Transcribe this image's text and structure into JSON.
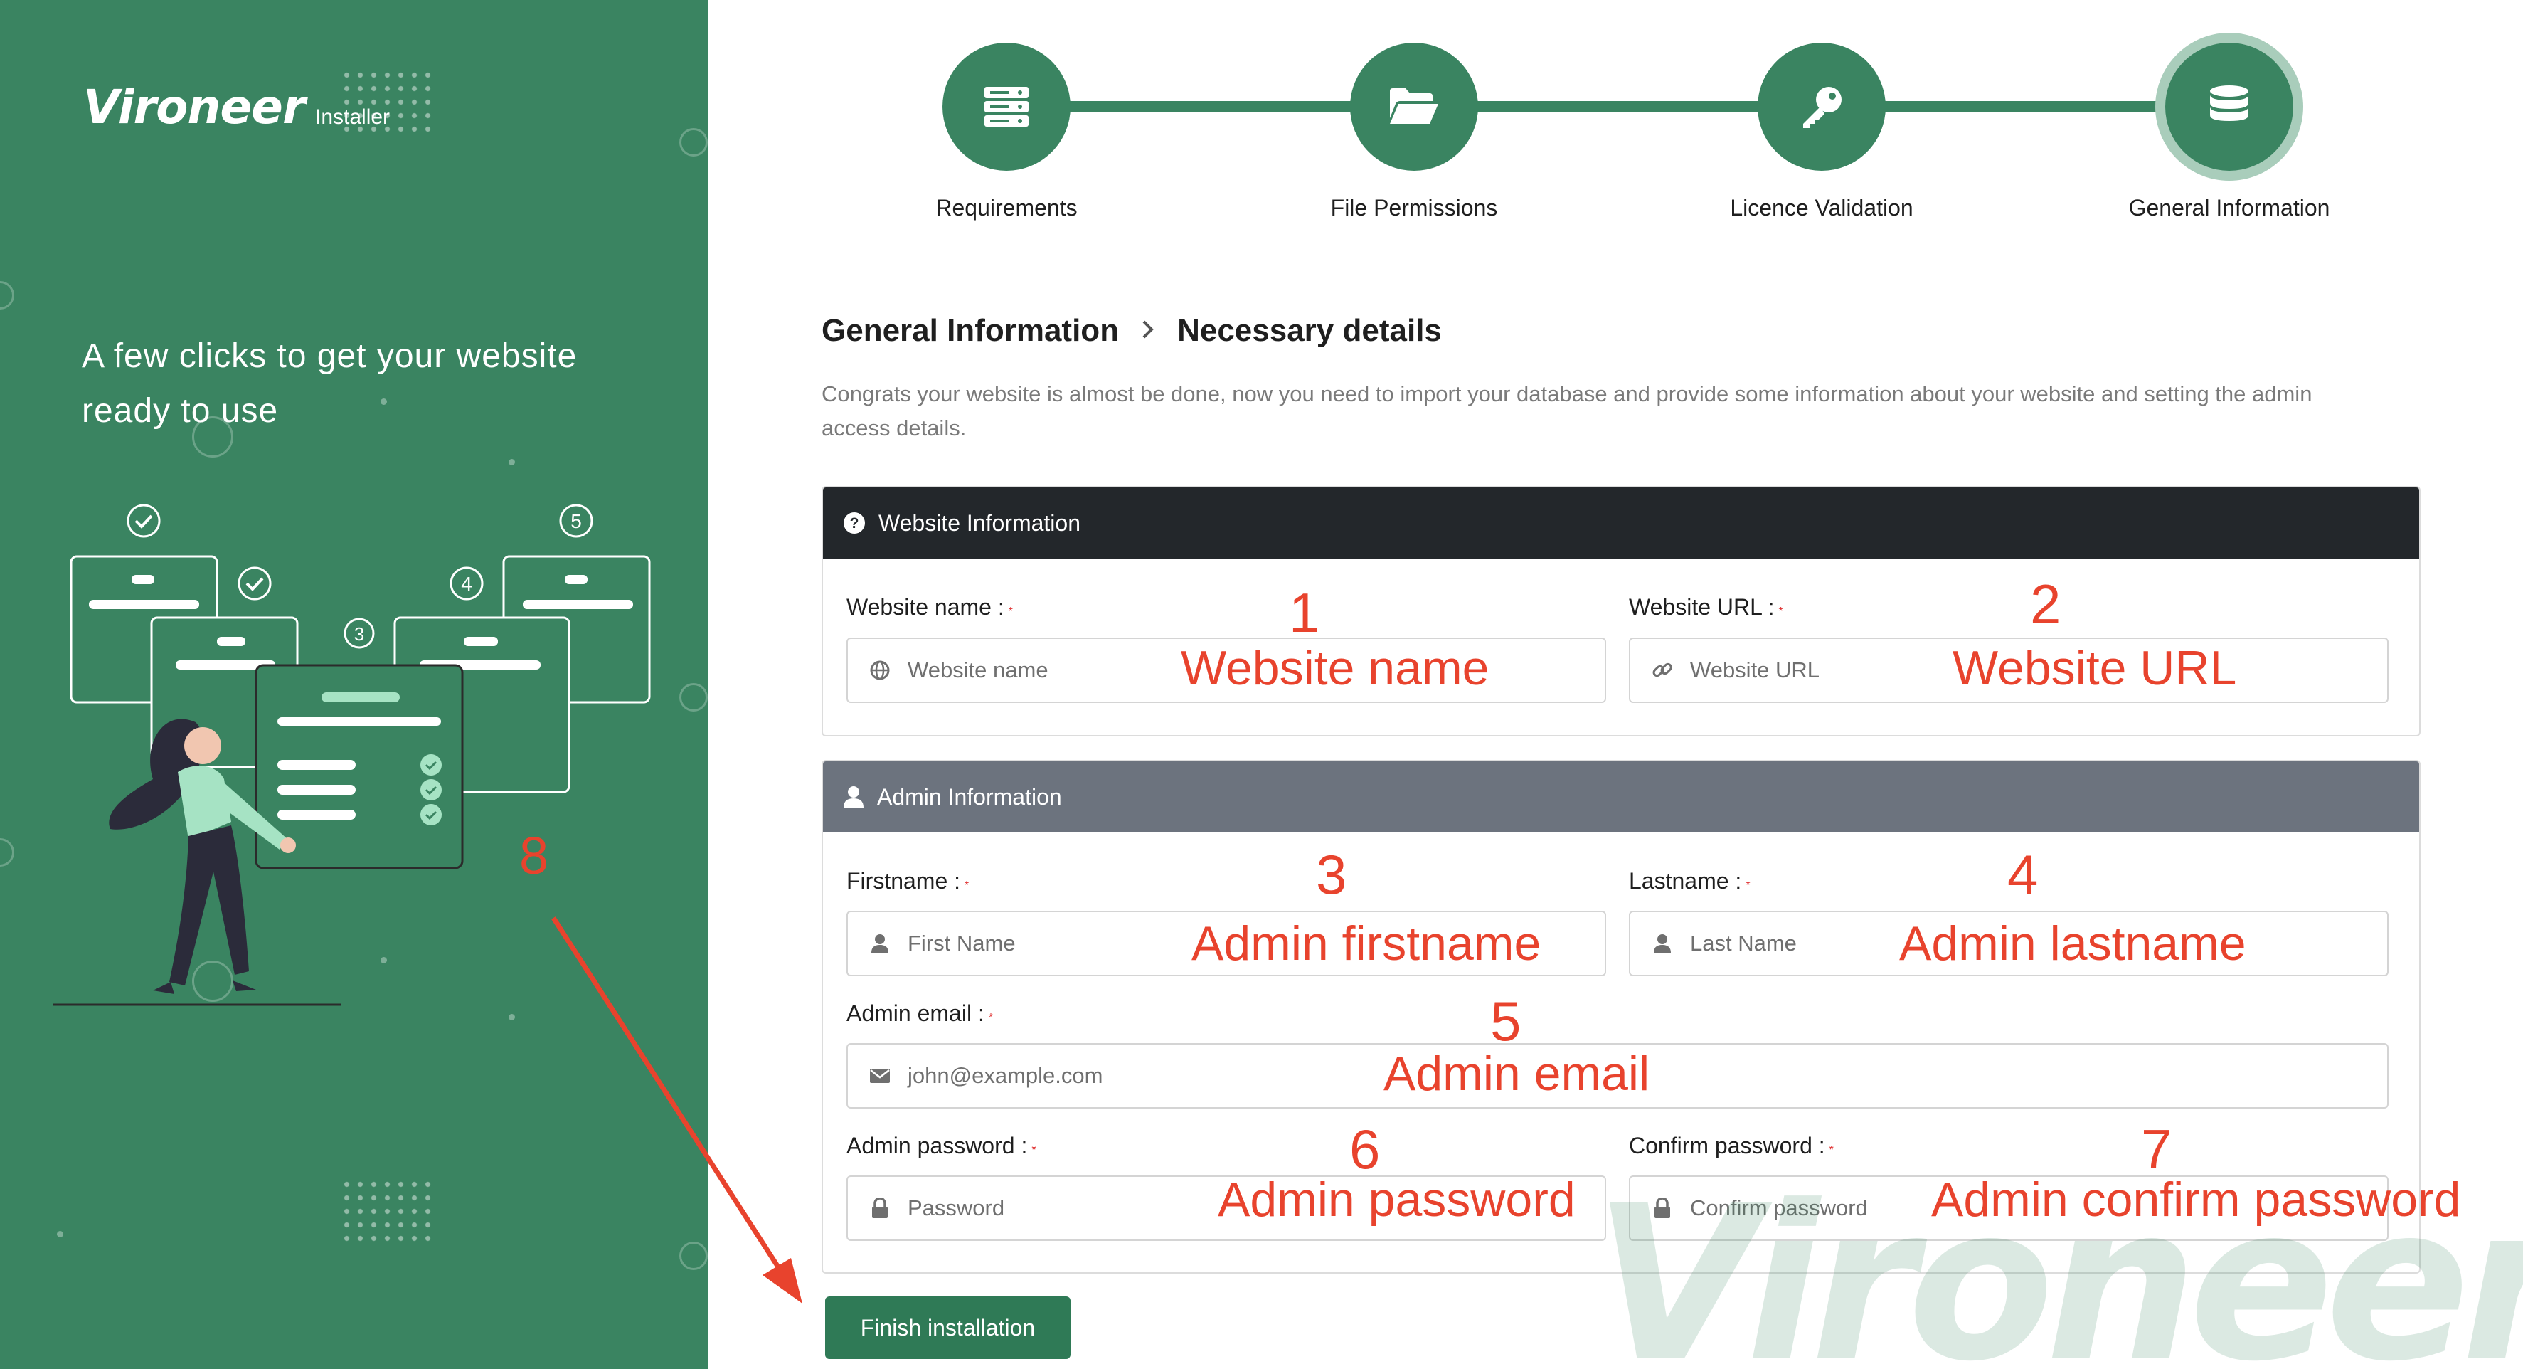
{
  "brand": {
    "name": "Vironeer",
    "sub": "Installer",
    "tagline": "A few clicks to get your website ready to use"
  },
  "steps": [
    {
      "label": "Requirements",
      "icon": "server-icon"
    },
    {
      "label": "File Permissions",
      "icon": "folder-open-icon"
    },
    {
      "label": "Licence Validation",
      "icon": "key-icon"
    },
    {
      "label": "General Information",
      "icon": "database-icon",
      "active": true
    }
  ],
  "illustration": {
    "steps": [
      "3",
      "4",
      "5"
    ]
  },
  "breadcrumb": {
    "parent": "General Information",
    "current": "Necessary details"
  },
  "intro": "Congrats your website is almost be done, now you need to import your database and provide some information about your website and setting the admin access details.",
  "website_section": {
    "title": "Website Information",
    "name_label": "Website name :",
    "name_placeholder": "Website name",
    "url_label": "Website URL :",
    "url_placeholder": "Website URL"
  },
  "admin_section": {
    "title": "Admin Information",
    "firstname_label": "Firstname :",
    "firstname_placeholder": "First Name",
    "lastname_label": "Lastname :",
    "lastname_placeholder": "Last Name",
    "email_label": "Admin email :",
    "email_placeholder": "john@example.com",
    "password_label": "Admin password :",
    "password_placeholder": "Password",
    "confirm_label": "Confirm password :",
    "confirm_placeholder": "Confirm password"
  },
  "required_mark": "*",
  "finish_button": "Finish installation",
  "watermark": "Vironeer",
  "annotations": {
    "n1": "1",
    "t1": "Website name",
    "n2": "2",
    "t2": "Website URL",
    "n3": "3",
    "t3": "Admin firstname",
    "n4": "4",
    "t4": "Admin lastname",
    "n5": "5",
    "t5": "Admin email",
    "n6": "6",
    "t6": "Admin password",
    "n7": "7",
    "t7": "Admin confirm password",
    "n8": "8"
  },
  "colors": {
    "brand_green": "#3a8461",
    "annotation_red": "#e8432d",
    "header_dark": "#23272b",
    "header_grey": "#6c737e"
  }
}
